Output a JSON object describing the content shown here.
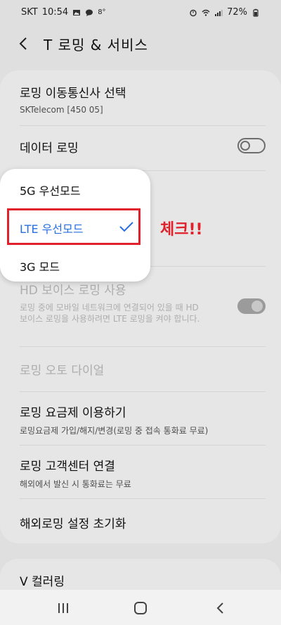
{
  "status_bar": {
    "carrier": "SKT",
    "time": "10:54",
    "temp": "8°",
    "battery": "72%",
    "icons": [
      "gallery-icon",
      "chat-icon",
      "alarm-icon",
      "wifi-icon",
      "signal-icon",
      "battery-icon"
    ]
  },
  "header": {
    "title": "T 로밍 & 서비스",
    "back_icon": "chevron-left-icon"
  },
  "settings": {
    "operator": {
      "title": "로밍 이동통신사 선택",
      "sub": "SKTelecom [450 05]"
    },
    "data_roaming": {
      "title": "데이터 로밍",
      "toggle": "off"
    },
    "hd_voice": {
      "title": "HD 보이스 로밍 사용",
      "sub": "로밍 중에 모바일 네트워크에 연결되어 있을 때 HD 보이스 로밍을 사용하려면 LTE 로밍을 켜야 합니다.",
      "toggle": "on"
    },
    "auto_dial": {
      "title": "로밍 오토 다이얼"
    },
    "rate_plan": {
      "title": "로밍 요금제 이용하기",
      "sub": "로밍요금제 가입/해지/변경(로밍 중 접속 통화료 무료)"
    },
    "customer_center": {
      "title": "로밍 고객센터 연결",
      "sub": "해외에서 발신 시 통화료는 무료"
    },
    "reset": {
      "title": "해외로밍 설정 초기화"
    }
  },
  "card2": {
    "title": "V 컬러링"
  },
  "popup": {
    "options": [
      {
        "label": "5G 우선모드",
        "selected": false
      },
      {
        "label": "LTE 우선모드",
        "selected": true
      },
      {
        "label": "3G 모드",
        "selected": false
      }
    ],
    "check_icon": "check-icon"
  },
  "annotation": {
    "text": "체크!!",
    "color": "#e0202a"
  },
  "colors": {
    "accent": "#2870e0",
    "highlight": "#e0202a"
  },
  "navbar": {
    "icons": [
      "recent-apps-icon",
      "home-icon",
      "back-icon"
    ]
  }
}
